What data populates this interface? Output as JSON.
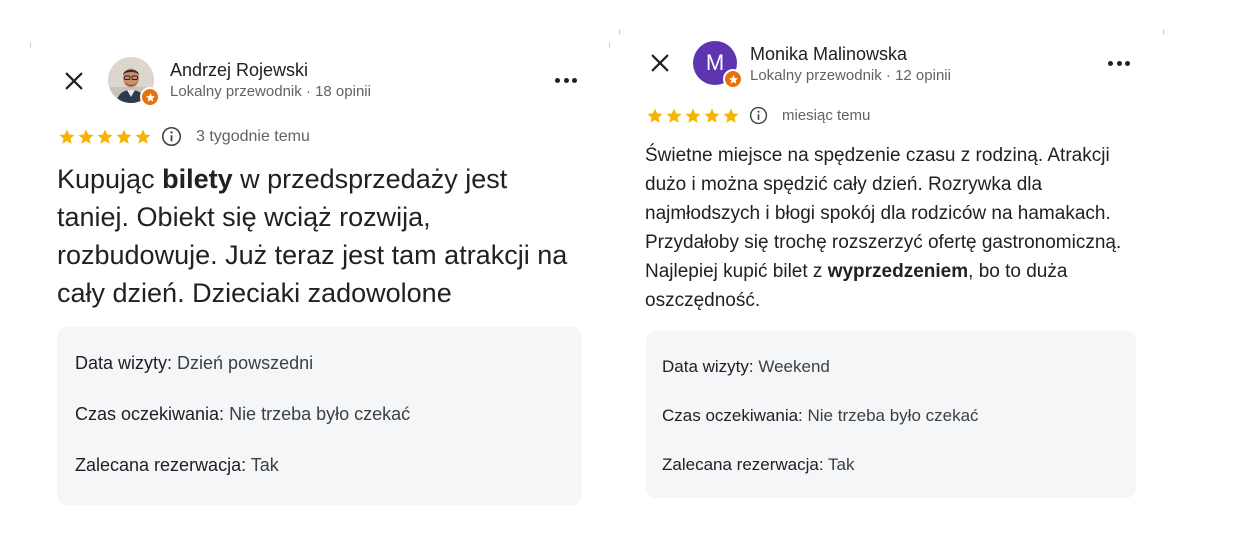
{
  "accent": {
    "star": "#f4b400",
    "badge": "#e8710a",
    "avatar_bg": "#5e35b1"
  },
  "reviews": [
    {
      "author_name": "Andrzej Rojewski",
      "author_meta": "Lokalny przewodnik · 18 opinii",
      "avatar_type": "photo",
      "rating": 5,
      "date": "3 tygodnie temu",
      "text_before": "Kupując ",
      "text_bold": "bilety",
      "text_after": " w przedsprzedaży jest taniej. Obiekt się wciąż rozwija, rozbudowuje. Już teraz jest tam atrakcji na cały dzień. Dzieciaki zadowolone",
      "details": [
        {
          "key": "Data wizyty:",
          "value": " Dzień powszedni"
        },
        {
          "key": "Czas oczekiwania:",
          "value": " Nie trzeba było czekać"
        },
        {
          "key": "Zalecana rezerwacja:",
          "value": " Tak"
        }
      ]
    },
    {
      "author_name": "Monika Malinowska",
      "author_meta": "Lokalny przewodnik · 12 opinii",
      "avatar_type": "letter",
      "avatar_letter": "M",
      "rating": 5,
      "date": "miesiąc temu",
      "text_before": "Świetne miejsce na spędzenie czasu z rodziną. Atrakcji dużo i można spędzić cały dzień. Rozrywka dla najmłodszych i błogi spokój dla rodziców na hamakach. Przydałoby się trochę rozszerzyć ofertę gastronomiczną. Najlepiej kupić bilet z ",
      "text_bold": "wyprzedzeniem",
      "text_after": ", bo to duża oszczędność.",
      "details": [
        {
          "key": "Data wizyty:",
          "value": " Weekend"
        },
        {
          "key": "Czas oczekiwania:",
          "value": " Nie trzeba było czekać"
        },
        {
          "key": "Zalecana rezerwacja:",
          "value": " Tak"
        }
      ]
    }
  ]
}
